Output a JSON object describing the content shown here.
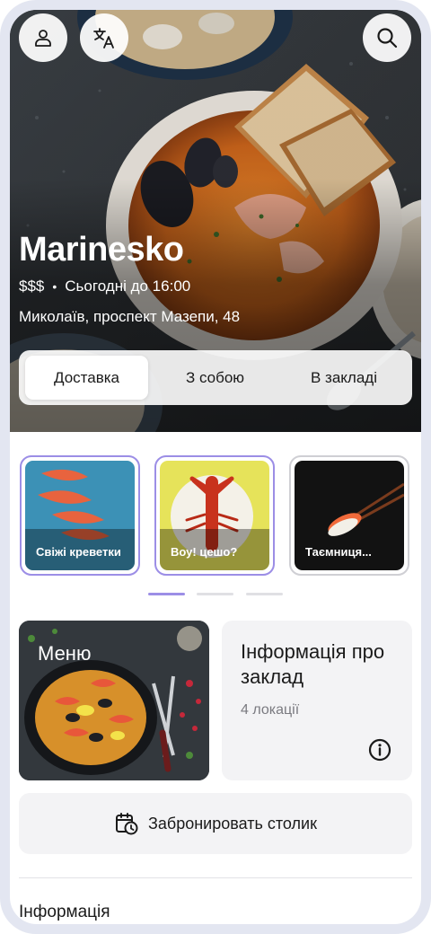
{
  "restaurant": {
    "name": "Marinesko",
    "price": "$$$",
    "hours": "Сьогодні до 16:00",
    "address": "Миколаїв, проспект Мазепи, 48"
  },
  "order_modes": [
    {
      "label": "Доставка",
      "active": true
    },
    {
      "label": "З собою",
      "active": false
    },
    {
      "label": "В закладі",
      "active": false
    }
  ],
  "stories": [
    {
      "label": "Свіжі креветки",
      "seen": false
    },
    {
      "label": "Воу! цешо?",
      "seen": false
    },
    {
      "label": "Таємниця...",
      "seen": true
    }
  ],
  "story_pager": {
    "count": 3,
    "active": 0
  },
  "menu_card": {
    "label": "Меню"
  },
  "info_card": {
    "title": "Інформація про заклад",
    "subtitle": "4 локації"
  },
  "book_button": {
    "label": "Забронировать столик"
  },
  "section": {
    "title": "Інформація"
  },
  "icons": {
    "profile": "user-icon",
    "translate": "translate-icon",
    "search": "search-icon",
    "info": "info-icon",
    "calendar": "calendar-clock-icon"
  },
  "colors": {
    "accent": "#9c8ee6",
    "card_bg": "#f3f3f5",
    "frame": "#e3e6f1"
  }
}
